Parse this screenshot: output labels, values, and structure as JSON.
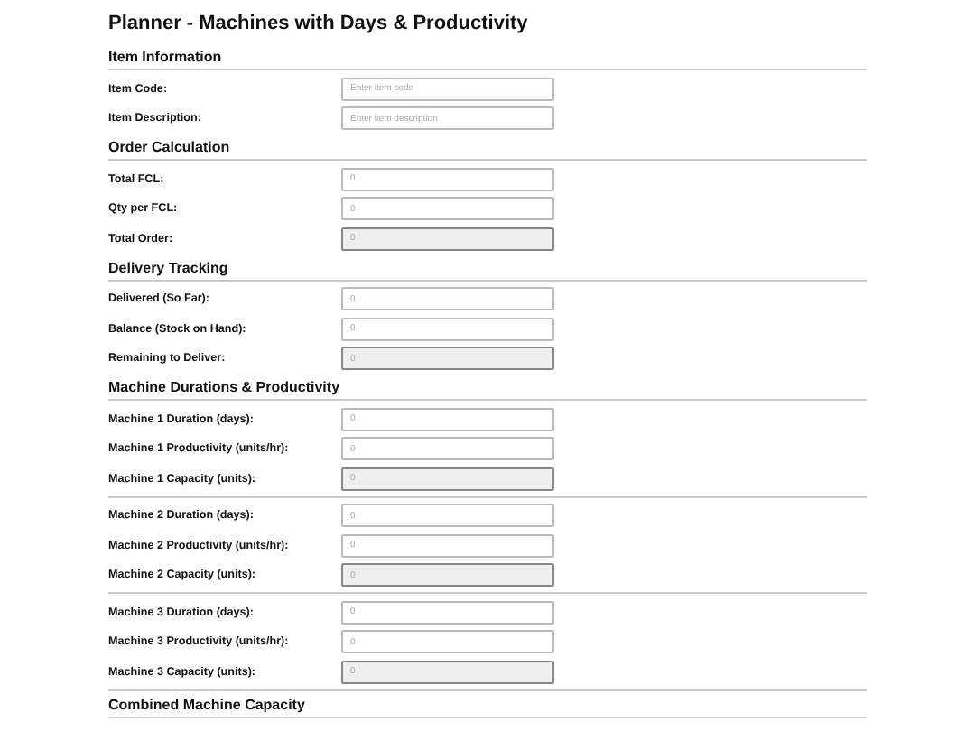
{
  "title": "Planner - Machines with Days & Productivity",
  "sections": [
    {
      "heading": "Item Information",
      "groups": [
        {
          "fields": [
            {
              "label": "Item Code:",
              "kind": "input",
              "placeholder": "Enter item code"
            },
            {
              "label": "Item Description:",
              "kind": "input",
              "placeholder": "Enter item description"
            }
          ]
        }
      ]
    },
    {
      "heading": "Order Calculation",
      "groups": [
        {
          "fields": [
            {
              "label": "Total FCL:",
              "kind": "input",
              "placeholder": "0"
            },
            {
              "label": "Qty per FCL:",
              "kind": "input",
              "placeholder": "0"
            },
            {
              "label": "Total Order:",
              "kind": "readonly",
              "placeholder": "0"
            }
          ]
        }
      ]
    },
    {
      "heading": "Delivery Tracking",
      "groups": [
        {
          "fields": [
            {
              "label": "Delivered (So Far):",
              "kind": "input",
              "placeholder": "0"
            },
            {
              "label": "Balance (Stock on Hand):",
              "kind": "input",
              "placeholder": "0"
            },
            {
              "label": "Remaining to Deliver:",
              "kind": "readonly",
              "placeholder": "0"
            }
          ]
        }
      ]
    },
    {
      "heading": "Machine Durations & Productivity",
      "groups": [
        {
          "fields": [
            {
              "label": "Machine 1 Duration (days):",
              "kind": "input",
              "placeholder": "0"
            },
            {
              "label": "Machine 1 Productivity (units/hr):",
              "kind": "input",
              "placeholder": "0"
            },
            {
              "label": "Machine 1 Capacity (units):",
              "kind": "readonly",
              "placeholder": "0"
            }
          ]
        },
        {
          "fields": [
            {
              "label": "Machine 2 Duration (days):",
              "kind": "input",
              "placeholder": "0"
            },
            {
              "label": "Machine 2 Productivity (units/hr):",
              "kind": "input",
              "placeholder": "0"
            },
            {
              "label": "Machine 2 Capacity (units):",
              "kind": "readonly",
              "placeholder": "0"
            }
          ]
        },
        {
          "fields": [
            {
              "label": "Machine 3 Duration (days):",
              "kind": "input",
              "placeholder": "0"
            },
            {
              "label": "Machine 3 Productivity (units/hr):",
              "kind": "input",
              "placeholder": "0"
            },
            {
              "label": "Machine 3 Capacity (units):",
              "kind": "readonly",
              "placeholder": "0"
            }
          ]
        }
      ]
    },
    {
      "heading": "Combined Machine Capacity"
    }
  ]
}
